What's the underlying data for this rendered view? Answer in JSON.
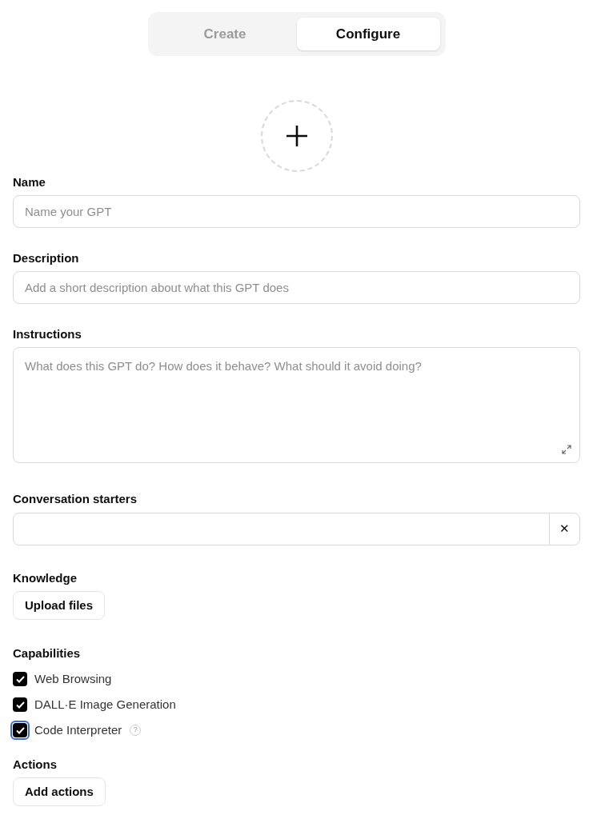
{
  "tabs": [
    {
      "label": "Create",
      "selected": false
    },
    {
      "label": "Configure",
      "selected": true
    }
  ],
  "fields": [
    {
      "label": "Name",
      "placeholder": "Name your GPT",
      "kind": "input"
    },
    {
      "label": "Description",
      "placeholder": "Add a short description about what this GPT does",
      "kind": "input"
    },
    {
      "label": "Instructions",
      "placeholder": "What does this GPT do? How does it behave? What should it avoid doing?",
      "kind": "textarea"
    }
  ],
  "conversation_starters": {
    "label": "Conversation starters",
    "remove_mark": "✕"
  },
  "knowledge": {
    "label": "Knowledge",
    "button": "Upload files"
  },
  "capabilities": {
    "label": "Capabilities",
    "items": [
      {
        "label": "Web Browsing",
        "checked": true,
        "focused": false
      },
      {
        "label": "DALL·E Image Generation",
        "checked": true,
        "focused": false
      },
      {
        "label": "Code Interpreter",
        "checked": true,
        "focused": true,
        "help_mark": "?"
      }
    ]
  },
  "actions": {
    "label": "Actions",
    "button": "Add actions"
  }
}
